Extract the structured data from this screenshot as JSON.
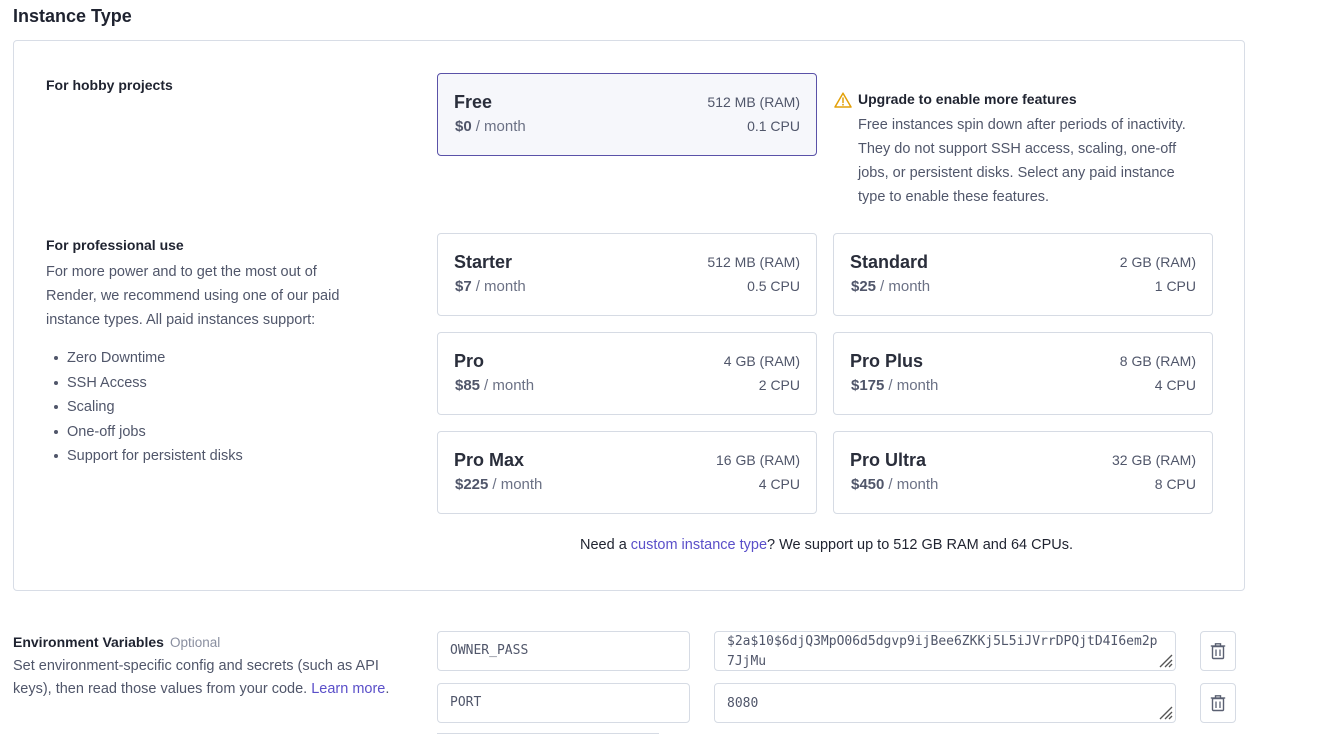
{
  "section": {
    "title": "Instance Type"
  },
  "hobby": {
    "label": "For hobby projects"
  },
  "professional": {
    "label": "For professional use",
    "description": "For more power and to get the most out of Render, we recommend using one of our paid instance types. All paid instances support:",
    "benefits": [
      "Zero Downtime",
      "SSH Access",
      "Scaling",
      "One-off jobs",
      "Support for persistent disks"
    ]
  },
  "instances": {
    "free": {
      "name": "Free",
      "price": "$0",
      "per": "/ month",
      "ram": "512 MB (RAM)",
      "cpu": "0.1 CPU",
      "selected": true
    },
    "starter": {
      "name": "Starter",
      "price": "$7",
      "per": "/ month",
      "ram": "512 MB (RAM)",
      "cpu": "0.5 CPU"
    },
    "standard": {
      "name": "Standard",
      "price": "$25",
      "per": "/ month",
      "ram": "2 GB (RAM)",
      "cpu": "1 CPU"
    },
    "pro": {
      "name": "Pro",
      "price": "$85",
      "per": "/ month",
      "ram": "4 GB (RAM)",
      "cpu": "2 CPU"
    },
    "pro_plus": {
      "name": "Pro Plus",
      "price": "$175",
      "per": "/ month",
      "ram": "8 GB (RAM)",
      "cpu": "4 CPU"
    },
    "pro_max": {
      "name": "Pro Max",
      "price": "$225",
      "per": "/ month",
      "ram": "16 GB (RAM)",
      "cpu": "4 CPU"
    },
    "pro_ultra": {
      "name": "Pro Ultra",
      "price": "$450",
      "per": "/ month",
      "ram": "32 GB (RAM)",
      "cpu": "8 CPU"
    }
  },
  "upgrade": {
    "icon": "warning-triangle-icon",
    "title": "Upgrade to enable more features",
    "body": "Free instances spin down after periods of inactivity. They do not support SSH access, scaling, one-off jobs, or persistent disks. Select any paid instance type to enable these features."
  },
  "custom": {
    "prefix": "Need a ",
    "link": "custom instance type",
    "suffix": "? We support up to 512 GB RAM and 64 CPUs."
  },
  "env": {
    "title": "Environment Variables",
    "optional": "Optional",
    "desc_prefix": "Set environment-specific config and secrets (such as API keys), then read those values from your code. ",
    "learn_more": "Learn more",
    "desc_suffix": ".",
    "rows": [
      {
        "key": "OWNER_PASS",
        "value": "$2a$10$6djQ3MpO06d5dgvp9ijBee6ZKKj5L5iJVrrDPQjtD4I6em2p7JjMu"
      },
      {
        "key": "PORT",
        "value": "8080"
      }
    ]
  },
  "colors": {
    "accent": "#5a4fc9",
    "selected_border": "#5a52a8",
    "warning": "#e3a008",
    "border": "#d6dbe4"
  }
}
